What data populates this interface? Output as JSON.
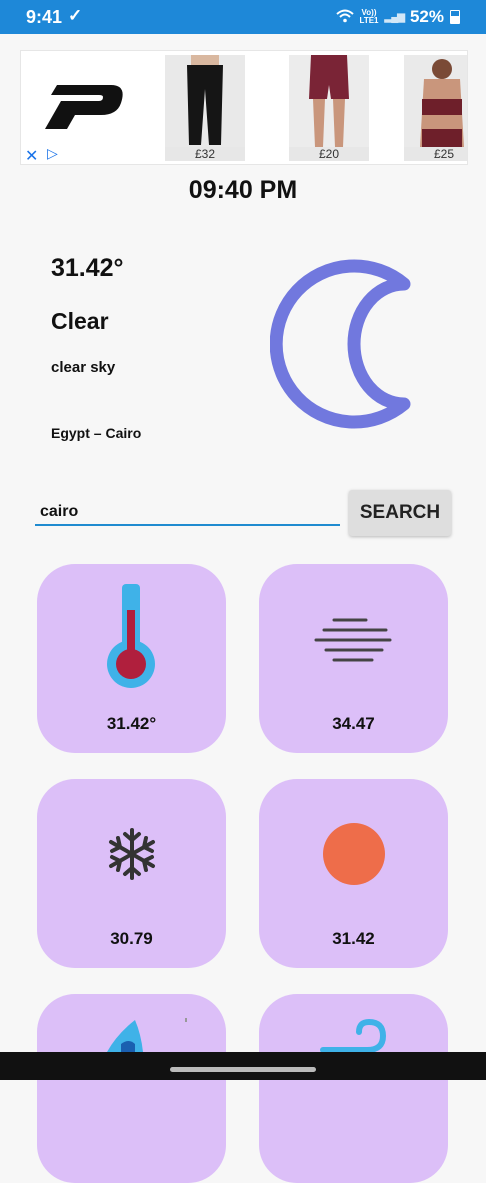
{
  "status_bar": {
    "time": "9:41",
    "notification_icon": "check-icon",
    "network_label_top": "Vo))",
    "network_label_bottom": "LTE1",
    "battery": "52%"
  },
  "ad": {
    "products": [
      {
        "price": "£32"
      },
      {
        "price": "£20"
      },
      {
        "price": "£25"
      }
    ],
    "close_icon": "close-icon",
    "adchoices_icon": "adchoices-icon"
  },
  "clock": "09:40 PM",
  "weather": {
    "temperature": "31.42°",
    "condition": "Clear",
    "description": "clear sky",
    "location": "Egypt – Cairo",
    "icon": "moon-icon",
    "icon_color": "#7178de"
  },
  "search": {
    "value": "cairo",
    "button_label": "SEARCH"
  },
  "cards": [
    {
      "icon": "thermometer-icon",
      "value": "31.42°"
    },
    {
      "icon": "haze-lines-icon",
      "value": "34.47"
    },
    {
      "icon": "snowflake-icon",
      "value": "30.79"
    },
    {
      "icon": "sun-circle-icon",
      "value": "31.42"
    },
    {
      "icon": "humidity-drop-icon",
      "value": ""
    },
    {
      "icon": "wind-icon",
      "value": ""
    }
  ],
  "colors": {
    "status_bar": "#1e88d8",
    "card_bg": "#dcbff8",
    "accent_underline": "#1f8bd0"
  }
}
